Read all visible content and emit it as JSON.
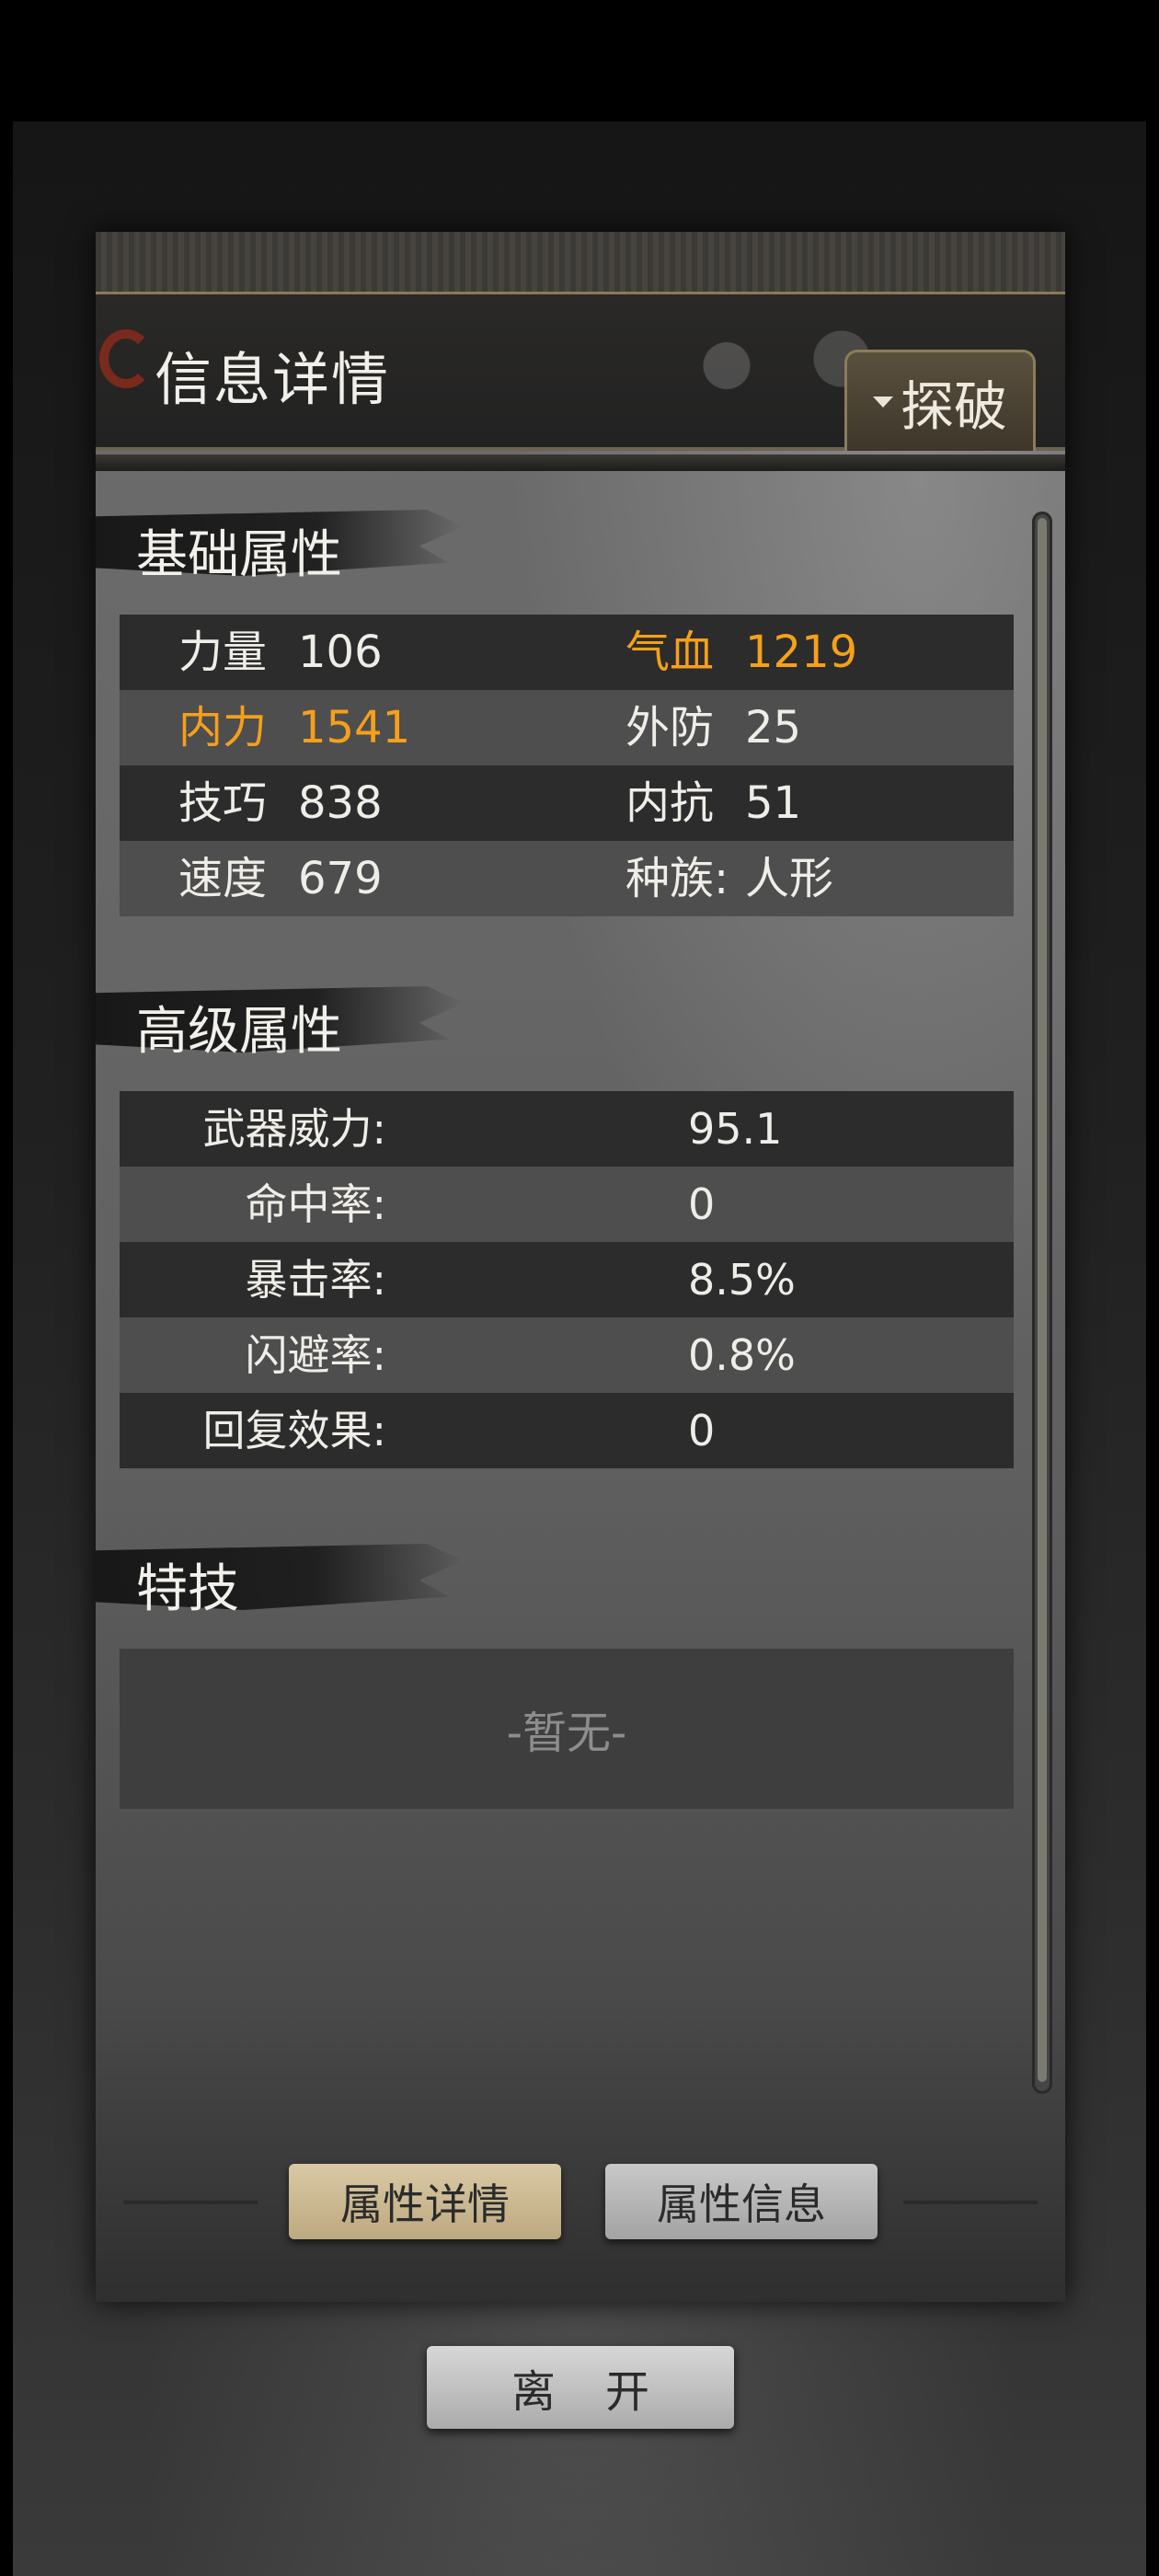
{
  "header": {
    "title": "信息详情",
    "explore_button": "探破"
  },
  "basic": {
    "heading": "基础属性",
    "rows": [
      {
        "left_label": "力量",
        "left_value": "106",
        "right_label": "气血",
        "right_value": "1219"
      },
      {
        "left_label": "内力",
        "left_value": "1541",
        "right_label": "外防",
        "right_value": "25"
      },
      {
        "left_label": "技巧",
        "left_value": "838",
        "right_label": "内抗",
        "right_value": "51"
      },
      {
        "left_label": "速度",
        "left_value": "679",
        "right_label": "种族: ",
        "right_value": "人形"
      }
    ]
  },
  "advanced": {
    "heading": "高级属性",
    "rows": [
      {
        "label": "武器威力:",
        "value": "95.1"
      },
      {
        "label": "命中率:",
        "value": "0"
      },
      {
        "label": "暴击率:",
        "value": "8.5%"
      },
      {
        "label": "闪避率:",
        "value": "0.8%"
      },
      {
        "label": "回复效果:",
        "value": "0"
      }
    ]
  },
  "skills": {
    "heading": "特技",
    "empty_text": "-暂无-"
  },
  "tabs": {
    "active": "属性详情",
    "inactive": "属性信息"
  },
  "leave_button": "离开",
  "colors": {
    "highlight": "#f5a01a",
    "tab_active": "#d9c9a4",
    "tab_inactive": "#c8c8c8"
  }
}
